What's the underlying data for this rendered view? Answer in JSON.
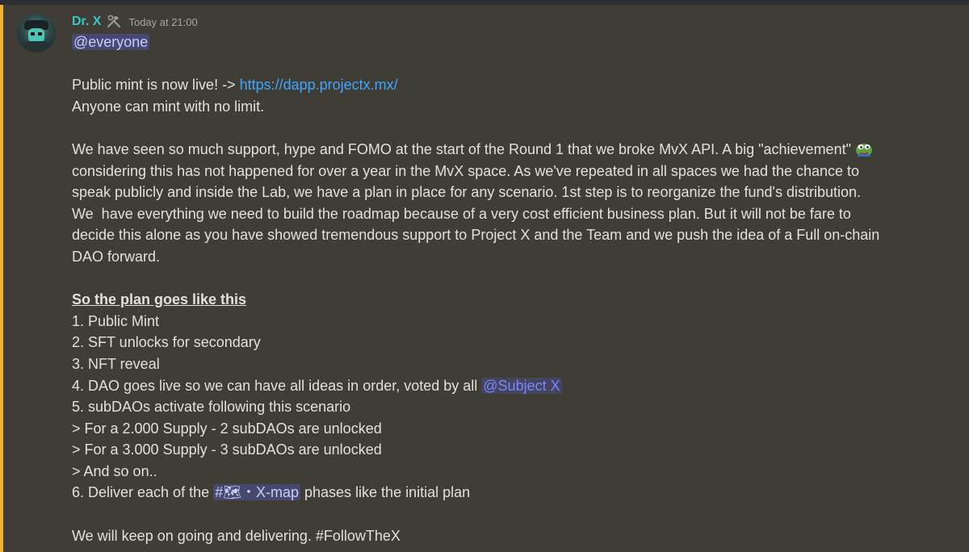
{
  "message": {
    "author": "Dr. X",
    "timestamp": "Today at 21:00",
    "role_icon": "hammer-wrench-icon",
    "colors": {
      "author": "#35c9c2",
      "link": "#3ea6ff",
      "mention_stripe": "#f0b232"
    },
    "mention_everyone": "@everyone",
    "line1_prefix": "Public mint is now live! -> ",
    "link_url": "https://dapp.projectx.mx/",
    "line2": "Anyone can mint with no limit.",
    "para": [
      "We have seen so much support, hype and FOMO at the start of the Round 1 that we broke MvX API. A big \"achievement\"",
      "considering this has not happened for over a year in the MvX space. As we've repeated in all spaces we had the chance to",
      "speak publicly and inside the Lab, we have a plan in place for any scenario. 1st step is to reorganize the fund's distribution.",
      "We  have everything we need to build the roadmap because of a very cost efficient business plan. But it will not be fare to",
      "decide this alone as you have showed tremendous support to Project X and the Team and we push the idea of a Full on-chain",
      "DAO forward."
    ],
    "plan_heading": "So the plan goes like this",
    "plan": {
      "item1": "1. Public Mint",
      "item2": "2. SFT unlocks for secondary",
      "item3": "3. NFT reveal",
      "item4_prefix": "4. DAO goes live so we can have all ideas in order, voted by all ",
      "item4_mention": "@Subject X",
      "item5": "5. subDAOs activate following this scenario",
      "sub1": "> For a 2.000 Supply - 2 subDAOs are unlocked",
      "sub2": "> For a 3.000 Supply - 3 subDAOs are unlocked",
      "sub3": "> And so on..",
      "item6_prefix": "6. Deliver each of the ",
      "item6_channel": "#🗺・X-map",
      "item6_suffix": " phases like the initial plan"
    },
    "closing": "We will keep on going and delivering. #FollowTheX"
  }
}
